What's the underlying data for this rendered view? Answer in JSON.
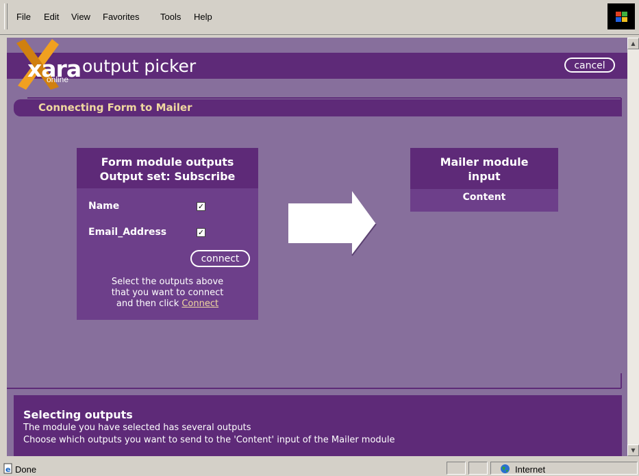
{
  "browser": {
    "menu": [
      "File",
      "Edit",
      "View",
      "Favorites",
      "Tools",
      "Help"
    ]
  },
  "header": {
    "logo_text": "xara",
    "logo_sub": "online",
    "title": "output picker",
    "cancel_label": "cancel"
  },
  "section": {
    "title": "Connecting Form  to Mailer"
  },
  "form_module": {
    "heading_line1": "Form module outputs",
    "heading_line2": "Output set: Subscribe",
    "outputs": [
      {
        "label": "Name",
        "checked": true
      },
      {
        "label": "Email_Address",
        "checked": true
      }
    ],
    "connect_label": "connect",
    "instruction_line1": "Select the outputs above",
    "instruction_line2": "that you want to connect",
    "instruction_line3_prefix": "and then click ",
    "instruction_link": "Connect"
  },
  "mailer_module": {
    "heading_line1": "Mailer module",
    "heading_line2": "input",
    "input_label": "Content"
  },
  "info": {
    "title": "Selecting outputs",
    "line1": "The module you have selected has several outputs",
    "line2": "Choose which outputs you want to send to the 'Content' input of the Mailer module"
  },
  "statusbar": {
    "status": "Done",
    "zone": "Internet"
  },
  "colors": {
    "page_bg": "#876f9c",
    "panel_dark": "#5e2a78",
    "panel_mid": "#6d3f8a",
    "accent_text": "#f0d8a0",
    "logo_orange": "#f0a020"
  }
}
